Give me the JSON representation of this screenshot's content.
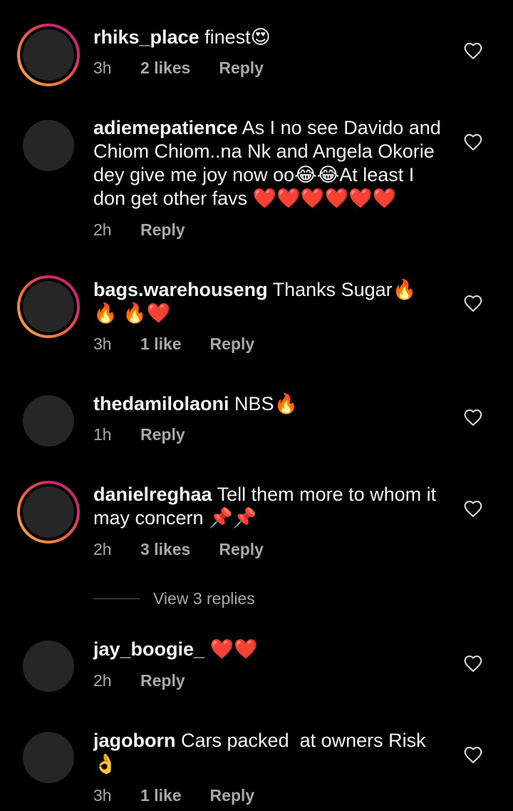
{
  "comments": [
    {
      "username": "rhiks_place",
      "text": "finest😍",
      "time": "3h",
      "likes": "2 likes",
      "reply_label": "Reply",
      "story_ring": true
    },
    {
      "username": "adiemepatience",
      "text": "As I no see Davido and Chiom Chiom..na Nk and Angela Okorie dey give me joy now oo😂😂At least I don get other favs ❤️❤️❤️❤️❤️❤️",
      "time": "2h",
      "likes": "",
      "reply_label": "Reply",
      "story_ring": false
    },
    {
      "username": "bags.warehouseng",
      "text": "Thanks Sugar🔥 🔥 🔥❤️",
      "time": "3h",
      "likes": "1 like",
      "reply_label": "Reply",
      "story_ring": true
    },
    {
      "username": "thedamilolaoni",
      "text": "NBS🔥",
      "time": "1h",
      "likes": "",
      "reply_label": "Reply",
      "story_ring": false
    },
    {
      "username": "danielreghaa",
      "text": "Tell them more to whom it may concern 📌📌",
      "time": "2h",
      "likes": "3 likes",
      "reply_label": "Reply",
      "story_ring": true
    },
    {
      "username": "jay_boogie_",
      "text": "❤️❤️",
      "time": "2h",
      "likes": "",
      "reply_label": "Reply",
      "story_ring": false
    },
    {
      "username": "jagoborn",
      "text": "Cars packed  at owners Risk 👌",
      "time": "3h",
      "likes": "1 like",
      "reply_label": "Reply",
      "story_ring": false
    }
  ],
  "view_replies": {
    "label": "View 3 replies"
  },
  "icons": {
    "like": "heart-outline-icon"
  },
  "colors": {
    "background": "#000000",
    "text": "#f5f5f5",
    "secondary_text": "#a8a8a8",
    "avatar_fill": "#262626",
    "story_ring_start": "#f8b24a",
    "story_ring_end": "#b7238a"
  }
}
